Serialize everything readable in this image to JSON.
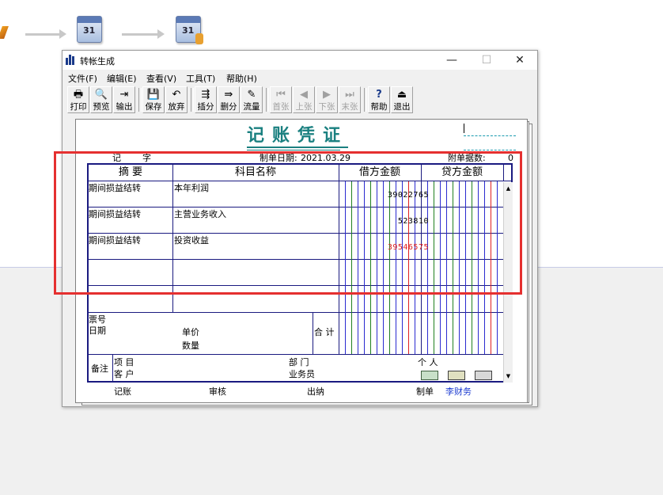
{
  "window": {
    "title": "转帐生成",
    "controls": {
      "minimize": "—",
      "maximize": "☐",
      "close": "✕"
    }
  },
  "menu": [
    "文件(F)",
    "编辑(E)",
    "查看(V)",
    "工具(T)",
    "帮助(H)"
  ],
  "toolbar": [
    {
      "label": "打印",
      "icon": "🖶"
    },
    {
      "label": "预览",
      "icon": "🔍"
    },
    {
      "label": "输出",
      "icon": "⇥"
    },
    {
      "label": "保存",
      "icon": "💾"
    },
    {
      "label": "放弃",
      "icon": "↶"
    },
    {
      "label": "插分",
      "icon": "⇶"
    },
    {
      "label": "删分",
      "icon": "⇛"
    },
    {
      "label": "流量",
      "icon": "✎"
    },
    {
      "label": "首张",
      "icon": "⏮"
    },
    {
      "label": "上张",
      "icon": "◀"
    },
    {
      "label": "下张",
      "icon": "▶"
    },
    {
      "label": "末张",
      "icon": "⏭"
    },
    {
      "label": "帮助",
      "icon": "?"
    },
    {
      "label": "退出",
      "icon": "⏏"
    }
  ],
  "desktop": {
    "calendar_day": "31"
  },
  "voucher": {
    "title": "记账凭证",
    "type_label": "记",
    "number_label": "字",
    "date_label": "制单日期:",
    "date": "2021.03.29",
    "attach_label": "附单据数:",
    "attach_value": "0",
    "columns": {
      "summary": "摘 要",
      "subject": "科目名称",
      "debit": "借方金额",
      "credit": "贷方金额"
    },
    "rows": [
      {
        "summary": "期间损益结转",
        "subject": "本年利润",
        "debit": "39022765",
        "debit_color": "#000000"
      },
      {
        "summary": "期间损益结转",
        "subject": "主营业务收入",
        "debit": "523810",
        "debit_color": "#000000"
      },
      {
        "summary": "期间损益结转",
        "subject": "投资收益",
        "debit": "39546575",
        "debit_color": "#e02020"
      }
    ],
    "ticket_no_label": "票号",
    "ticket_date_label": "日期",
    "unit_price_label": "单价",
    "quantity_label": "数量",
    "total_label": "合 计",
    "remarks_label": "备注",
    "project_label": "项  目",
    "customer_label": "客  户",
    "department_label": "部  门",
    "salesman_label": "业务员",
    "person_label": "个  人",
    "bookkeeping_label": "记账",
    "review_label": "审核",
    "cashier_label": "出纳",
    "maker_label": "制单",
    "maker_name": "李财务"
  }
}
